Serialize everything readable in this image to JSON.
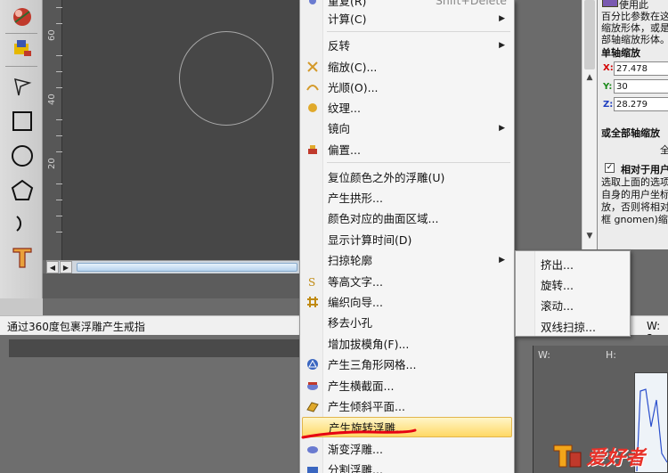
{
  "canvas": {
    "ruler_labels": [
      "60",
      "40",
      "20"
    ]
  },
  "status_bar": {
    "message": "通过360度包裹浮雕产生戒指",
    "w_label": "W: 2"
  },
  "bottom": {
    "w_label": "W:",
    "h_label": "H:"
  },
  "context_menu": {
    "partial_top_label": "重复(R)",
    "partial_top_shortcut": "Shift+Delete",
    "items": [
      {
        "label": "计算(C)",
        "submenu": true
      },
      {
        "label": "反转",
        "submenu": true
      },
      {
        "label": "缩放(C)...",
        "icon": "scale-icon"
      },
      {
        "label": "光顺(O)...",
        "icon": "smooth-icon"
      },
      {
        "label": "纹理...",
        "icon": "texture-icon"
      },
      {
        "label": "镜向",
        "submenu": true
      },
      {
        "label": "偏置...",
        "icon": "offset-icon"
      },
      {
        "label": "复位颜色之外的浮雕(U)"
      },
      {
        "label": "产生拱形..."
      },
      {
        "label": "颜色对应的曲面区域..."
      },
      {
        "label": "显示计算时间(D)"
      },
      {
        "label": "扫掠轮廓",
        "submenu": true
      },
      {
        "label": "等高文字...",
        "icon": "contour-text-icon"
      },
      {
        "label": "编织向导...",
        "icon": "weave-icon"
      },
      {
        "label": "移去小孔"
      },
      {
        "label": "增加拔模角(F)..."
      },
      {
        "label": "产生三角形网格...",
        "icon": "triangle-mesh-icon"
      },
      {
        "label": "产生横截面...",
        "icon": "cross-section-icon"
      },
      {
        "label": "产生倾斜平面...",
        "icon": "tilted-plane-icon"
      },
      {
        "label": "产生旋转浮雕...",
        "highlighted": true
      },
      {
        "label": "渐变浮雕...",
        "icon": "gradient-icon"
      },
      {
        "label": "分割浮雕...",
        "icon": "split-icon"
      }
    ]
  },
  "submenu": {
    "items": [
      "挤出...",
      "旋转...",
      "滚动...",
      "双线扫掠..."
    ]
  },
  "right_panel": {
    "line1": "使用此",
    "line2": "百分比参数在这",
    "line3": "缩放形体，或是",
    "line4": "部轴缩放形体。",
    "single_axis_title": "单轴缩放",
    "x_label": "X:",
    "x_value": "27.478",
    "y_label": "Y:",
    "y_value": "30",
    "z_label": "Z:",
    "z_value": "28.279",
    "all_axis_title": "或全部轴缩放",
    "all_axis_suffix": "全",
    "relative_label": "相对于用户",
    "desc1": "选取上面的选项",
    "desc2": "自身的用户坐标",
    "desc3": "放，否则将相对",
    "desc4": "框  gnomen)缩放",
    "colors": {
      "x": "#d40000",
      "y": "#1b8a1b",
      "z": "#1f3fc0"
    }
  },
  "watermark": {
    "text": "爱好者"
  }
}
